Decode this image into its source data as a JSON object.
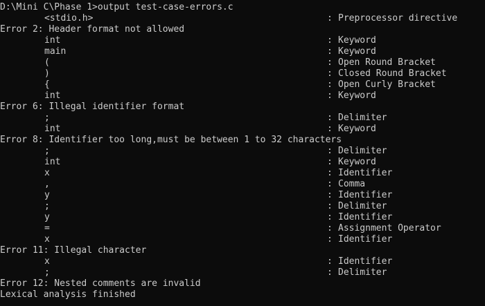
{
  "console": {
    "prompt": "D:\\Mini C\\Phase 1>output test-case-errors.c",
    "separator": ":",
    "lines": [
      {
        "type": "token",
        "lexeme": "<stdio.h>",
        "token": "Preprocessor directive"
      },
      {
        "type": "error",
        "text": "Error 2: Header format not allowed"
      },
      {
        "type": "token",
        "lexeme": "int",
        "token": "Keyword"
      },
      {
        "type": "token",
        "lexeme": "main",
        "token": "Keyword"
      },
      {
        "type": "token",
        "lexeme": "(",
        "token": "Open Round Bracket"
      },
      {
        "type": "token",
        "lexeme": ")",
        "token": "Closed Round Bracket"
      },
      {
        "type": "token",
        "lexeme": "{",
        "token": "Open Curly Bracket"
      },
      {
        "type": "token",
        "lexeme": "int",
        "token": "Keyword"
      },
      {
        "type": "error",
        "text": "Error 6: Illegal identifier format"
      },
      {
        "type": "token",
        "lexeme": ";",
        "token": "Delimiter"
      },
      {
        "type": "token",
        "lexeme": "int",
        "token": "Keyword"
      },
      {
        "type": "error",
        "text": "Error 8: Identifier too long,must be between 1 to 32 characters"
      },
      {
        "type": "token",
        "lexeme": ";",
        "token": "Delimiter"
      },
      {
        "type": "token",
        "lexeme": "int",
        "token": "Keyword"
      },
      {
        "type": "token",
        "lexeme": "x",
        "token": "Identifier"
      },
      {
        "type": "token",
        "lexeme": ",",
        "token": "Comma"
      },
      {
        "type": "token",
        "lexeme": "y",
        "token": "Identifier"
      },
      {
        "type": "token",
        "lexeme": ";",
        "token": "Delimiter"
      },
      {
        "type": "token",
        "lexeme": "y",
        "token": "Identifier"
      },
      {
        "type": "token",
        "lexeme": "=",
        "token": "Assignment Operator"
      },
      {
        "type": "token",
        "lexeme": "x",
        "token": "Identifier"
      },
      {
        "type": "error",
        "text": "Error 11: Illegal character"
      },
      {
        "type": "token",
        "lexeme": "x",
        "token": "Identifier"
      },
      {
        "type": "token",
        "lexeme": ";",
        "token": "Delimiter"
      },
      {
        "type": "error",
        "text": "Error 12: Nested comments are invalid"
      },
      {
        "type": "message",
        "text": "Lexical analysis finished"
      }
    ]
  },
  "colors": {
    "background": "#0c0c0c",
    "foreground": "#cccccc"
  }
}
